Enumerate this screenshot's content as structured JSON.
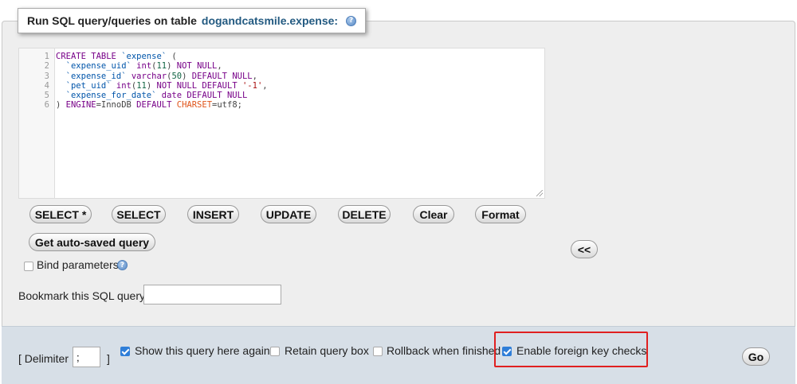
{
  "legend": {
    "prefix": "Run SQL query/queries on table",
    "table": "dogandcatsmile.expense:",
    "help_glyph": "?"
  },
  "editor": {
    "lines": [
      {
        "n": "1",
        "parts": [
          {
            "t": "CREATE TABLE ",
            "c": "kw"
          },
          {
            "t": "`expense`",
            "c": "id"
          },
          {
            "t": " (",
            "c": ""
          }
        ]
      },
      {
        "n": "2",
        "parts": [
          {
            "t": "  ",
            "c": ""
          },
          {
            "t": "`expense_uid`",
            "c": "id"
          },
          {
            "t": " ",
            "c": ""
          },
          {
            "t": "int",
            "c": "kw"
          },
          {
            "t": "(",
            "c": ""
          },
          {
            "t": "11",
            "c": "num"
          },
          {
            "t": ") ",
            "c": ""
          },
          {
            "t": "NOT NULL",
            "c": "kw"
          },
          {
            "t": ",",
            "c": ""
          }
        ]
      },
      {
        "n": "3",
        "parts": [
          {
            "t": "  ",
            "c": ""
          },
          {
            "t": "`expense_id`",
            "c": "id"
          },
          {
            "t": " ",
            "c": ""
          },
          {
            "t": "varchar",
            "c": "kw"
          },
          {
            "t": "(",
            "c": ""
          },
          {
            "t": "50",
            "c": "num"
          },
          {
            "t": ") ",
            "c": ""
          },
          {
            "t": "DEFAULT NULL",
            "c": "kw"
          },
          {
            "t": ",",
            "c": ""
          }
        ]
      },
      {
        "n": "4",
        "parts": [
          {
            "t": "  ",
            "c": ""
          },
          {
            "t": "`pet_uid`",
            "c": "id"
          },
          {
            "t": " ",
            "c": ""
          },
          {
            "t": "int",
            "c": "kw"
          },
          {
            "t": "(",
            "c": ""
          },
          {
            "t": "11",
            "c": "num"
          },
          {
            "t": ") ",
            "c": ""
          },
          {
            "t": "NOT NULL DEFAULT",
            "c": "kw"
          },
          {
            "t": " ",
            "c": ""
          },
          {
            "t": "'-1'",
            "c": "str"
          },
          {
            "t": ",",
            "c": ""
          }
        ]
      },
      {
        "n": "5",
        "parts": [
          {
            "t": "  ",
            "c": ""
          },
          {
            "t": "`expense_for_date`",
            "c": "id"
          },
          {
            "t": " ",
            "c": ""
          },
          {
            "t": "date",
            "c": "kw"
          },
          {
            "t": " ",
            "c": ""
          },
          {
            "t": "DEFAULT NULL",
            "c": "kw"
          }
        ]
      },
      {
        "n": "6",
        "parts": [
          {
            "t": ") ",
            "c": ""
          },
          {
            "t": "ENGINE",
            "c": "kw"
          },
          {
            "t": "=InnoDB ",
            "c": ""
          },
          {
            "t": "DEFAULT",
            "c": "kw"
          },
          {
            "t": " ",
            "c": ""
          },
          {
            "t": "CHARSET",
            "c": "kw2"
          },
          {
            "t": "=utf8;",
            "c": ""
          }
        ]
      }
    ]
  },
  "buttons": {
    "select_star": "SELECT *",
    "select": "SELECT",
    "insert": "INSERT",
    "update": "UPDATE",
    "delete": "DELETE",
    "clear": "Clear",
    "format": "Format",
    "get_autosaved": "Get auto-saved query",
    "collapse": "<<",
    "go": "Go"
  },
  "bind_parameters": {
    "label": "Bind parameters",
    "checked": false
  },
  "bookmark": {
    "label": "Bookmark this SQL query:",
    "value": ""
  },
  "options": {
    "delimiter_open": "[ Delimiter",
    "delimiter_value": ";",
    "delimiter_close": "]",
    "show_query": {
      "label": "Show this query here again",
      "checked": true
    },
    "retain_box": {
      "label": "Retain query box",
      "checked": false
    },
    "rollback": {
      "label": "Rollback when finished",
      "checked": false
    },
    "foreign_keys": {
      "label": "Enable foreign key checks",
      "checked": true
    }
  }
}
